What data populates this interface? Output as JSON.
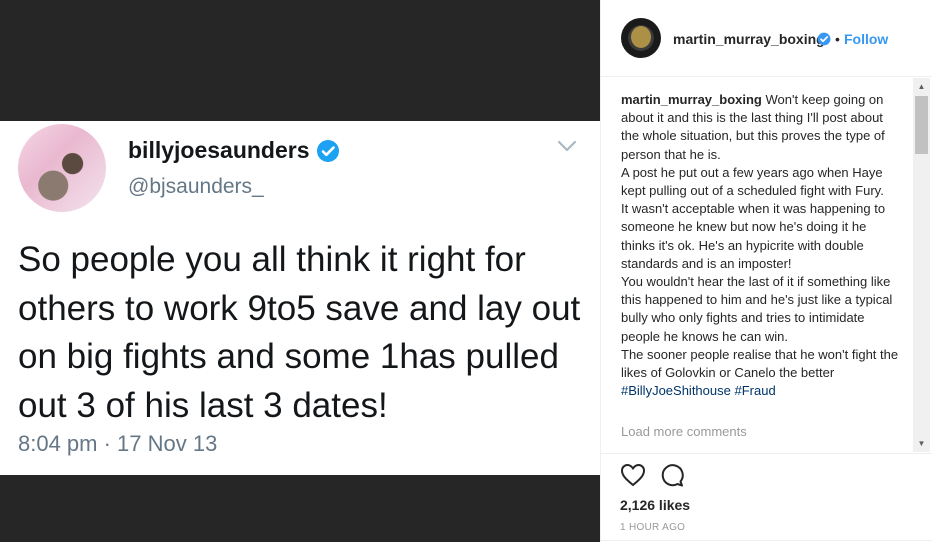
{
  "tweet": {
    "name": "billyjoesaunders",
    "handle": "@bjsaunders_",
    "text": "So people you all think it right for others to work 9to5 save and lay out on big fights and some 1has pulled out 3 of his last 3 dates!",
    "date": "8:04 pm · 17 Nov 13"
  },
  "post": {
    "username": "martin_murray_boxing",
    "dot": "•",
    "follow_label": "Follow",
    "caption": "Won't keep going on about it and this is the last thing I'll post about the whole situation, but this proves the type of person that he is.\nA post he put out a few years ago when Haye kept pulling out of a scheduled fight with Fury.\nIt wasn't acceptable when it was happening to someone he knew but now he's doing it he thinks it's ok. He's an hypicrite with double standards and is an imposter!\nYou wouldn't hear the last of it if something like this happened to him and he's just like a typical bully who only fights and tries to intimidate people he knows he can win.\nThe sooner people realise that he won't fight the likes of Golovkin or Canelo the better ",
    "hashtag1": "#BillyJoeShithouse",
    "hashtag2": "#Fraud",
    "load_more": "Load more comments",
    "likes": "2,126 likes",
    "time": "1 HOUR AGO"
  },
  "icons": {
    "verified": "verified-badge-icon",
    "heart": "heart-icon",
    "comment": "comment-icon",
    "chevron": "chevron-down-icon"
  },
  "colors": {
    "link": "#3897f0",
    "hashtag": "#003569",
    "media_bg": "#262626"
  }
}
